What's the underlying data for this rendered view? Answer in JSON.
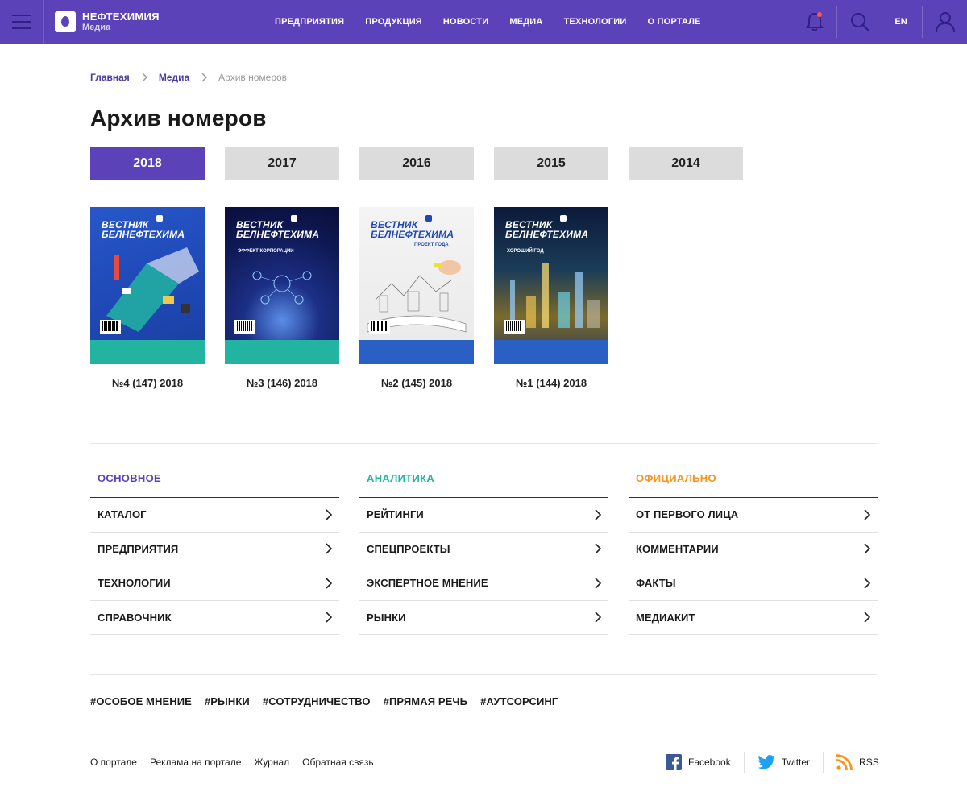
{
  "header": {
    "logo_title": "НЕФТЕХИМИЯ",
    "logo_sub": "Медиа",
    "nav": [
      "ПРЕДПРИЯТИЯ",
      "ПРОДУКЦИЯ",
      "НОВОСТИ",
      "МЕДИА",
      "ТЕХНОЛОГИИ",
      "О ПОРТАЛЕ"
    ],
    "lang": "EN"
  },
  "breadcrumb": {
    "items": [
      "Главная",
      "Медиа"
    ],
    "current": "Архив номеров"
  },
  "page_title": "Архив номеров",
  "years": {
    "items": [
      "2018",
      "2017",
      "2016",
      "2015",
      "2014"
    ],
    "active": "2018"
  },
  "issues": [
    {
      "label": "№4 (147) 2018",
      "masthead": "ВЕСТНИК БЕЛНЕФТЕХИМА"
    },
    {
      "label": "№3 (146) 2018",
      "masthead": "ВЕСТНИК БЕЛНЕФТЕХИМА",
      "cover_text": "ЭФФЕКТ КОРПОРАЦИИ"
    },
    {
      "label": "№2 (145) 2018",
      "masthead": "ВЕСТНИК БЕЛНЕФТЕХИМА",
      "cover_text": "ПРОЕКТ ГОДА"
    },
    {
      "label": "№1 (144) 2018",
      "masthead": "ВЕСТНИК БЕЛНЕФТЕХИМА",
      "cover_text": "ХОРОШИЙ ГОД"
    }
  ],
  "footer_menus": [
    {
      "title": "ОСНОВНОЕ",
      "color": "#5c42b8",
      "items": [
        "КАТАЛОГ",
        "ПРЕДПРИЯТИЯ",
        "ТЕХНОЛОГИИ",
        "СПРАВОЧНИК"
      ]
    },
    {
      "title": "АНАЛИТИКА",
      "color": "#20b8a0",
      "items": [
        "РЕЙТИНГИ",
        "СПЕЦПРОЕКТЫ",
        "ЭКСПЕРТНОЕ МНЕНИЕ",
        "РЫНКИ"
      ]
    },
    {
      "title": "ОФИЦИАЛЬНО",
      "color": "#f7941d",
      "items": [
        "ОТ ПЕРВОГО ЛИЦА",
        "КОММЕНТАРИИ",
        "ФАКТЫ",
        "МЕДИАКИТ"
      ]
    }
  ],
  "tags": [
    "#ОСОБОЕ МНЕНИЕ",
    "#РЫНКИ",
    "#СОТРУДНИЧЕСТВО",
    "#ПРЯМАЯ РЕЧЬ",
    "#АУТСОРСИНГ"
  ],
  "footer_links": [
    "О портале",
    "Реклама на портале",
    "Журнал",
    "Обратная связь"
  ],
  "social": [
    {
      "label": "Facebook",
      "icon": "facebook-icon",
      "color": "#3b5998"
    },
    {
      "label": "Twitter",
      "icon": "twitter-icon",
      "color": "#1da1f2"
    },
    {
      "label": "RSS",
      "icon": "rss-icon",
      "color": "#f7941d"
    }
  ],
  "colors": {
    "brand": "#5c42b8",
    "notification_dot": "#ff5a3c"
  }
}
